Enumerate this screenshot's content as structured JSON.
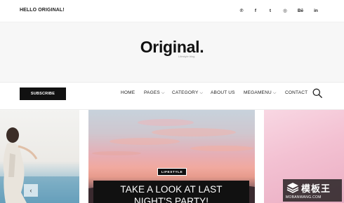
{
  "topbar": {
    "greeting": "HELLO ORIGINAL!",
    "social_icons": [
      {
        "name": "pinterest-icon",
        "glyph": "℗"
      },
      {
        "name": "facebook-icon",
        "glyph": "f"
      },
      {
        "name": "twitter-icon",
        "glyph": "t"
      },
      {
        "name": "dribbble-icon",
        "glyph": "◎"
      },
      {
        "name": "behance-icon",
        "glyph": "Bē"
      },
      {
        "name": "linkedin-icon",
        "glyph": "in"
      }
    ]
  },
  "header": {
    "logo": "Original.",
    "tagline": "Lifestyle blog"
  },
  "nav": {
    "subscribe_label": "SUBSCRIBE",
    "items": [
      {
        "label": "HOME",
        "dropdown": false
      },
      {
        "label": "PAGES",
        "dropdown": true
      },
      {
        "label": "CATEGORY",
        "dropdown": true
      },
      {
        "label": "ABOUT US",
        "dropdown": false
      },
      {
        "label": "MEGAMENU",
        "dropdown": true
      },
      {
        "label": "CONTACT",
        "dropdown": false
      }
    ],
    "search_icon": "search-icon"
  },
  "slider": {
    "prev_arrow": "‹",
    "featured": {
      "category": "LIFESTYLE",
      "title_line1": "TAKE A LOOK AT LAST",
      "title_line2": "NIGHT'S PARTY!"
    }
  },
  "watermark": {
    "text_cn": "模板王",
    "text_en": "MOBANWANG.COM"
  },
  "colors": {
    "dark": "#111111",
    "background": "#f7f7f7"
  }
}
